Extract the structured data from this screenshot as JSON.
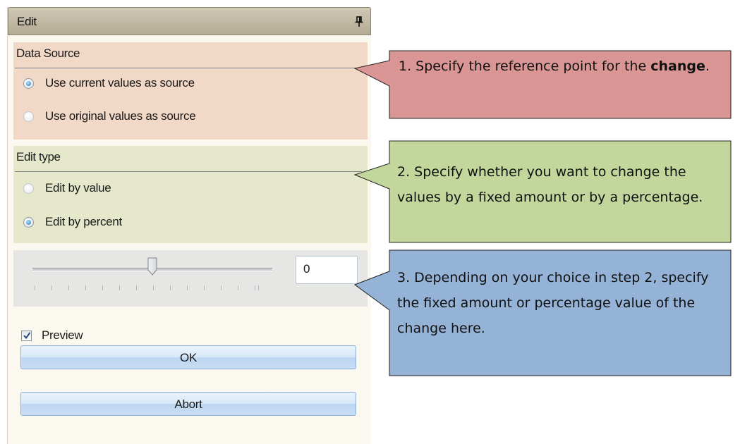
{
  "panel": {
    "title": "Edit",
    "data_source": {
      "title": "Data Source",
      "options": [
        {
          "label": "Use current values as source",
          "checked": true
        },
        {
          "label": "Use original values as source",
          "checked": false
        }
      ]
    },
    "edit_type": {
      "title": "Edit type",
      "options": [
        {
          "label": "Edit by value",
          "checked": false
        },
        {
          "label": "Edit by percent",
          "checked": true
        }
      ]
    },
    "slider": {
      "value": "0"
    },
    "preview": {
      "label": "Preview",
      "checked": true
    },
    "ok_label": "OK",
    "abort_label": "Abort"
  },
  "callouts": [
    {
      "text_before": "1. Specify the reference point for the ",
      "bold": "change",
      "text_after": ".",
      "color": "#d99694"
    },
    {
      "text": "2. Specify whether you want to change the values by a fixed amount or by a percentage.",
      "color": "#c3d69b"
    },
    {
      "text": "3. Depending on your choice in step 2, specify the fixed amount or percentage value of the change here.",
      "color": "#95b3d7"
    }
  ],
  "colors": {
    "header": "#c1b9a2",
    "data_source_bg": "#f2d9c7",
    "edit_type_bg": "#e6e8cc",
    "slider_bg": "#e6e7e4"
  }
}
